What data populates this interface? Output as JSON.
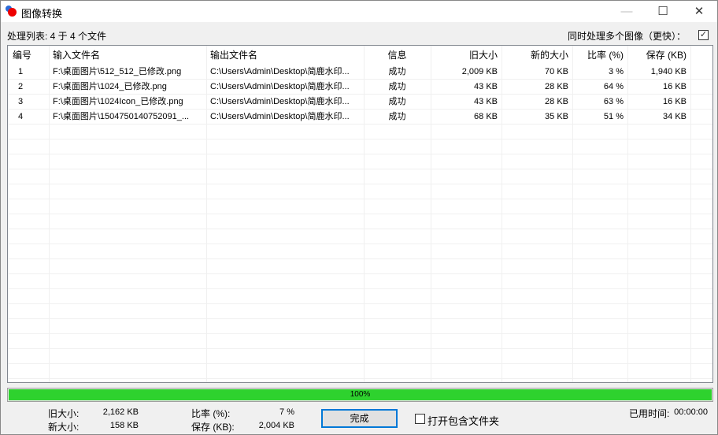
{
  "window": {
    "title": "图像转换"
  },
  "status_text": "处理列表: 4 于 4 个文件",
  "multi_thread": {
    "label": "同时处理多个图像（更快）：",
    "checked": true,
    "mark": "✓"
  },
  "table": {
    "headers": [
      "编号",
      "输入文件名",
      "输出文件名",
      "信息",
      "旧大小",
      "新的大小",
      "比率 (%)",
      "保存 (KB)"
    ],
    "rows": [
      [
        "1",
        "F:\\桌面图片\\512_512_已修改.png",
        "C:\\Users\\Admin\\Desktop\\简鹿水印...",
        "成功",
        "2,009 KB",
        "70 KB",
        "3 %",
        "1,940 KB"
      ],
      [
        "2",
        "F:\\桌面图片\\1024_已修改.png",
        "C:\\Users\\Admin\\Desktop\\简鹿水印...",
        "成功",
        "43 KB",
        "28 KB",
        "64 %",
        "16 KB"
      ],
      [
        "3",
        "F:\\桌面图片\\1024Icon_已修改.png",
        "C:\\Users\\Admin\\Desktop\\简鹿水印...",
        "成功",
        "43 KB",
        "28 KB",
        "63 %",
        "16 KB"
      ],
      [
        "4",
        "F:\\桌面图片\\1504750140752091_...",
        "C:\\Users\\Admin\\Desktop\\简鹿水印...",
        "成功",
        "68 KB",
        "35 KB",
        "51 %",
        "34 KB"
      ]
    ]
  },
  "progress": {
    "percent": 100,
    "label": "100%",
    "color": "#2ed22e"
  },
  "summary": {
    "old_size_label": "旧大小:",
    "old_size": "2,162 KB",
    "new_size_label": "新大小:",
    "new_size": "158 KB",
    "ratio_label": "比率 (%):",
    "ratio": "7 %",
    "saved_label": "保存 (KB):",
    "saved": "2,004 KB",
    "elapsed_label": "已用时间:",
    "elapsed": "00:00:00"
  },
  "done_button": "完成",
  "open_folder": {
    "label": "打开包含文件夹",
    "checked": false
  }
}
